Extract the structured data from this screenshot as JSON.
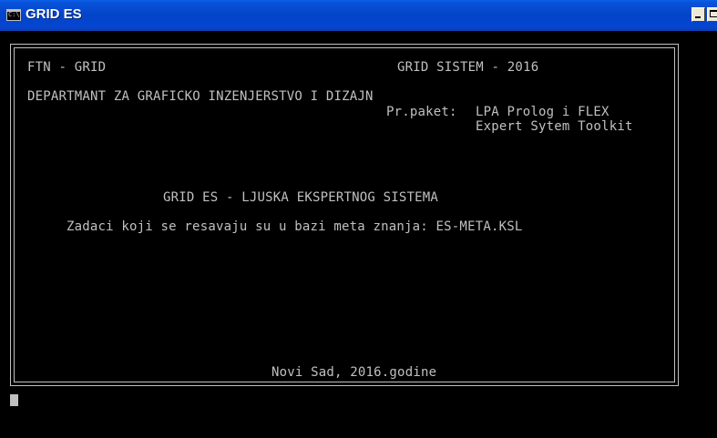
{
  "window": {
    "title": "GRID ES",
    "icon": "console-icon"
  },
  "screen": {
    "line1_left": "FTN - GRID",
    "line1_right": "GRID SISTEM - 2016",
    "line2": "DEPARTMANT ZA GRAFICKO INZENJERSTVO I DIZAJN",
    "package_label": "Pr.paket:",
    "package_line1": "LPA Prolog i FLEX",
    "package_line2": "Expert Sytem Toolkit",
    "heading": "GRID ES - LJUSKA EKSPERTNOG SISTEMA",
    "description": "Zadaci koji se resavaju su u bazi meta znanja: ES-META.KSL",
    "footer": "Novi Sad, 2016.godine"
  },
  "colors": {
    "titlebar": "#0343c8",
    "console_bg": "#000000",
    "console_text": "#c0c0c0"
  }
}
